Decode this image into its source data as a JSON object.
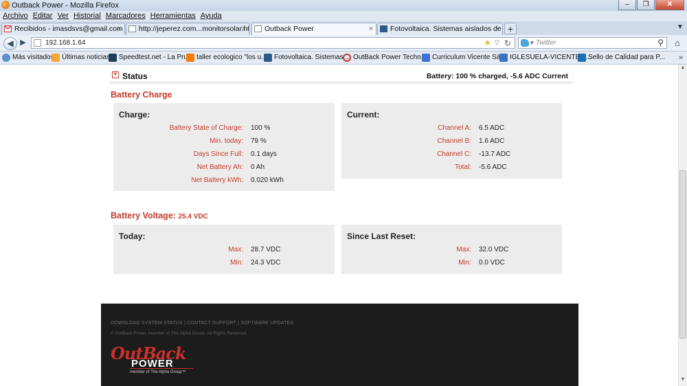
{
  "window": {
    "title": "Outback Power - Mozilla Firefox"
  },
  "menubar": [
    "Archivo",
    "Editar",
    "Ver",
    "Historial",
    "Marcadores",
    "Herramientas",
    "Ayuda"
  ],
  "tabs": [
    {
      "label": "Recibidos - imasdsvs@gmail.com - G...",
      "icon": "gmail-icon"
    },
    {
      "label": "http://jeperez.com...monitorsolar.html",
      "icon": "blank-page-icon"
    },
    {
      "label": "Outback Power",
      "icon": "blank-page-icon",
      "active": true
    },
    {
      "label": "Fotovoltaica. Sistemas aislados de la r...",
      "icon": "blog-icon"
    }
  ],
  "navbar": {
    "url": "192.168.1.64",
    "search_placeholder": "Twitter"
  },
  "bookmarks": [
    {
      "label": "Más visitados",
      "icon": "globe-icon"
    },
    {
      "label": "Últimas noticias",
      "icon": "rss-icon"
    },
    {
      "label": "Speedtest.net - La Pru...",
      "icon": "speedtest-icon"
    },
    {
      "label": "taller ecologico \"los u...",
      "icon": "blogger-icon"
    },
    {
      "label": "Fotovoltaica. Sistemas ...",
      "icon": "blog-icon"
    },
    {
      "label": "OutBack Power Techn...",
      "icon": "outback-icon"
    },
    {
      "label": "Curriculum Vicente Sá...",
      "icon": "doc-icon"
    },
    {
      "label": "IGLESUELA-VICENTE: [...",
      "icon": "rss-icon"
    },
    {
      "label": "Sello de Calidad para P...",
      "icon": "seal-icon"
    }
  ],
  "status": {
    "title": "Status",
    "summary": "Battery: 100 % charged, -5.6 ADC Current"
  },
  "battery_charge": {
    "heading": "Battery Charge",
    "charge": {
      "title": "Charge:",
      "rows": [
        {
          "label": "Battery State of Charge:",
          "value": "100 %"
        },
        {
          "label": "Min. today:",
          "value": "79 %"
        },
        {
          "label": "Days Since Full:",
          "value": "0.1 days"
        },
        {
          "label": "Net Battery Ah:",
          "value": "0 Ah"
        },
        {
          "label": "Net Battery kWh:",
          "value": "0.020 kWh"
        }
      ]
    },
    "current": {
      "title": "Current:",
      "rows": [
        {
          "label": "Channel A:",
          "value": "6.5 ADC"
        },
        {
          "label": "Channel B:",
          "value": "1.6 ADC"
        },
        {
          "label": "Channel C:",
          "value": "-13.7 ADC"
        },
        {
          "label": "Total:",
          "value": "-5.6 ADC"
        }
      ]
    }
  },
  "battery_voltage": {
    "heading": "Battery Voltage:",
    "value": "25.4 VDC",
    "today": {
      "title": "Today:",
      "rows": [
        {
          "label": "Max:",
          "value": "28.7 VDC"
        },
        {
          "label": "Min:",
          "value": "24.3 VDC"
        }
      ]
    },
    "since_reset": {
      "title": "Since Last Reset:",
      "rows": [
        {
          "label": "Max:",
          "value": "32.0 VDC"
        },
        {
          "label": "Min:",
          "value": "0.0 VDC"
        }
      ]
    }
  },
  "footer": {
    "links": "DOWNLOAD SYSTEM STATUS | CONTACT SUPPORT | SOFTWARE UPDATES",
    "copyright": "© OutBack Power, member of The Alpha Group. All Rights Reserved.",
    "logo_top": "OutBack",
    "logo_bottom": "POWER",
    "logo_member": "member of The Alpha Group™"
  },
  "colors": {
    "accent": "#c53a2b",
    "panel": "#ececec",
    "footer": "#1c1c1c"
  }
}
